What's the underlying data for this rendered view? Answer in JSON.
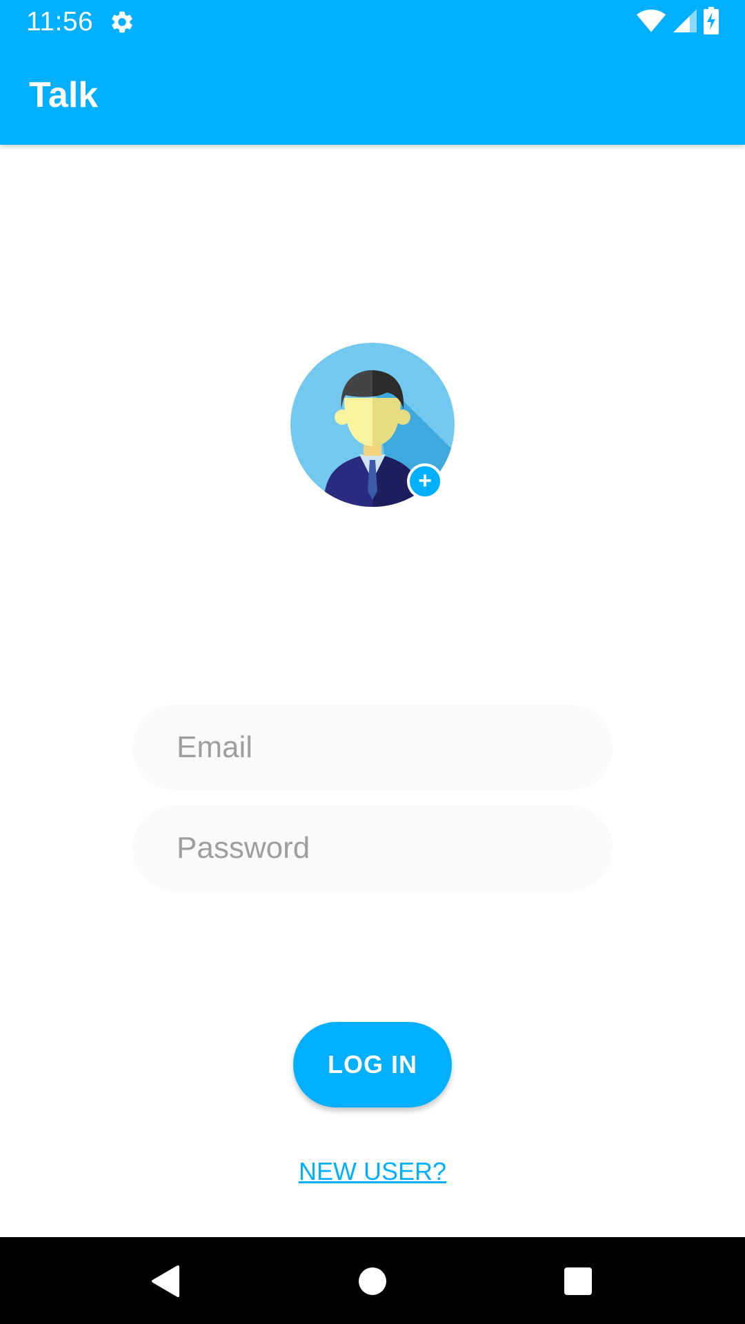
{
  "status_bar": {
    "time": "11:56",
    "icons": [
      "gear-icon",
      "wifi-icon",
      "signal-icon",
      "battery-charging-icon"
    ]
  },
  "app_bar": {
    "title": "Talk"
  },
  "avatar": {
    "icon": "person-avatar-icon",
    "add_icon": "plus-icon",
    "add_label": "+"
  },
  "form": {
    "email_placeholder": "Email",
    "email_value": "",
    "password_placeholder": "Password",
    "password_value": "",
    "login_label": "LOG IN",
    "new_user_label": "NEW USER?"
  },
  "nav_bar": {
    "icons": [
      "back-icon",
      "home-icon",
      "recents-icon"
    ]
  },
  "colors": {
    "primary": "#00B0FF",
    "field_background": "#FAFAFA",
    "placeholder": "#9E9E9E",
    "nav_background": "#000000"
  }
}
